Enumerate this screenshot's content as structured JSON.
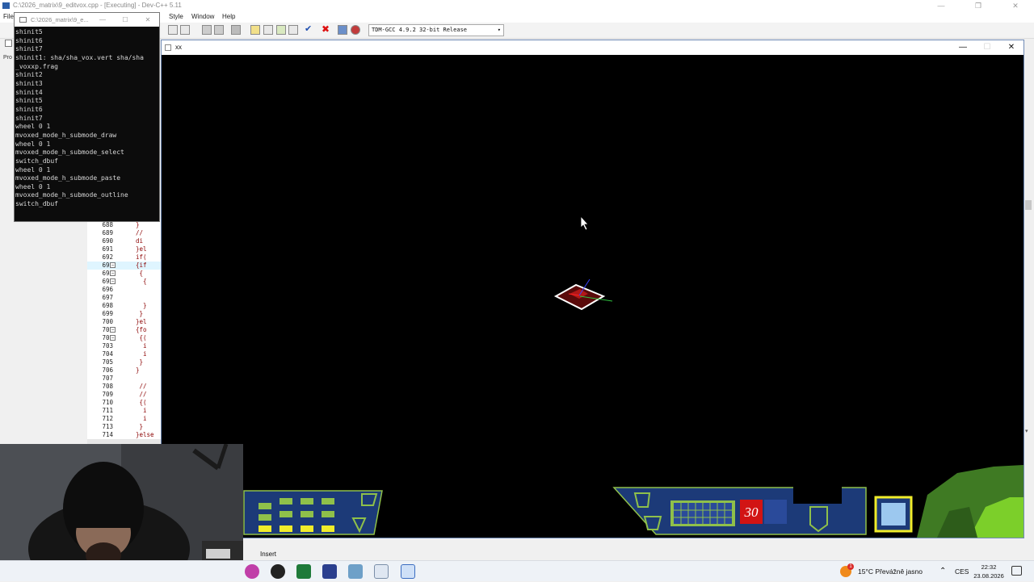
{
  "ide": {
    "title": "C:\\2026_matrix\\9_editvox.cpp - [Executing] - Dev-C++ 5.11",
    "menu": [
      "File",
      "Style",
      "Window",
      "Help"
    ],
    "side_tab_label": "Pro",
    "compiler": "TDM-GCC 4.9.2 32-bit Release",
    "status_mode": "Insert",
    "win_buttons": [
      "—",
      "❐",
      "✕"
    ],
    "code_lines": [
      {
        "n": "688",
        "fold": "",
        "code": "}"
      },
      {
        "n": "689",
        "fold": "",
        "code": "//"
      },
      {
        "n": "690",
        "fold": "",
        "code": "di"
      },
      {
        "n": "691",
        "fold": "",
        "code": "}el"
      },
      {
        "n": "692",
        "fold": "",
        "code": "if("
      },
      {
        "n": "693",
        "fold": "−",
        "code": "{if"
      },
      {
        "n": "694",
        "fold": "−",
        "code": " {"
      },
      {
        "n": "695",
        "fold": "−",
        "code": "  {"
      },
      {
        "n": "696",
        "fold": "",
        "code": ""
      },
      {
        "n": "697",
        "fold": "",
        "code": ""
      },
      {
        "n": "698",
        "fold": "",
        "code": "  }"
      },
      {
        "n": "699",
        "fold": "",
        "code": " }"
      },
      {
        "n": "700",
        "fold": "",
        "code": "}el"
      },
      {
        "n": "701",
        "fold": "−",
        "code": "{fo"
      },
      {
        "n": "702",
        "fold": "−",
        "code": " {("
      },
      {
        "n": "703",
        "fold": "",
        "code": "  i"
      },
      {
        "n": "704",
        "fold": "",
        "code": "  i"
      },
      {
        "n": "705",
        "fold": "",
        "code": " }"
      },
      {
        "n": "706",
        "fold": "",
        "code": "}"
      },
      {
        "n": "707",
        "fold": "",
        "code": ""
      },
      {
        "n": "708",
        "fold": "",
        "code": " //"
      },
      {
        "n": "709",
        "fold": "",
        "code": " //"
      },
      {
        "n": "710",
        "fold": "",
        "code": " {("
      },
      {
        "n": "711",
        "fold": "",
        "code": "  i"
      },
      {
        "n": "712",
        "fold": "",
        "code": "  i"
      },
      {
        "n": "713",
        "fold": "",
        "code": " }"
      },
      {
        "n": "714",
        "fold": "",
        "code": "}else"
      }
    ]
  },
  "console": {
    "title": "C:\\2026_matrix\\9_e...",
    "lines": [
      "shinit5",
      "shinit6",
      "shinit7",
      "shinit1: sha/sha_vox.vert sha/sha",
      "_voxxp.frag",
      "shinit2",
      "shinit3",
      "shinit4",
      "shinit5",
      "shinit6",
      "shinit7",
      "wheel 0 1",
      "mvoxed_mode_h_submode_draw",
      "wheel 0 1",
      "mvoxed_mode_h_submode_select",
      "switch_dbuf",
      "wheel 0 1",
      "mvoxed_mode_h_submode_paste",
      "wheel 0 1",
      "mvoxed_mode_h_submode_outline",
      "switch_dbuf"
    ]
  },
  "game": {
    "title": "xx",
    "counter": "30",
    "colors": {
      "hud_fill": "#1c3a78",
      "hud_green": "#8fc04a",
      "hud_yellow": "#f0ec2a",
      "counter_bg": "#d21414"
    }
  },
  "taskbar": {
    "weather": "15°C  Převážně jasno",
    "lang": "CES",
    "time": "22:32",
    "date": "23.08.2026",
    "notif_badge": "1"
  }
}
